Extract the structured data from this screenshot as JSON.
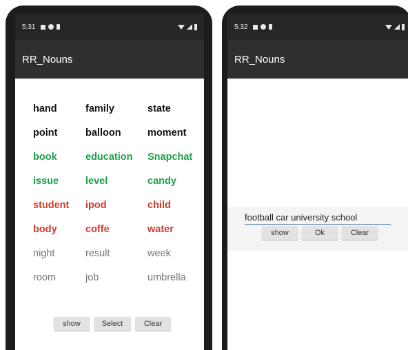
{
  "left_screen": {
    "status": {
      "time": "5:31"
    },
    "app_title": "RR_Nouns",
    "words": [
      {
        "text": "hand",
        "color": "black"
      },
      {
        "text": "family",
        "color": "black"
      },
      {
        "text": "state",
        "color": "black"
      },
      {
        "text": "point",
        "color": "black"
      },
      {
        "text": "balloon",
        "color": "black"
      },
      {
        "text": "moment",
        "color": "black"
      },
      {
        "text": "book",
        "color": "green"
      },
      {
        "text": "education",
        "color": "green"
      },
      {
        "text": "Snapchat",
        "color": "green"
      },
      {
        "text": "issue",
        "color": "green"
      },
      {
        "text": "level",
        "color": "green"
      },
      {
        "text": "candy",
        "color": "green"
      },
      {
        "text": "student",
        "color": "red"
      },
      {
        "text": "ipod",
        "color": "red"
      },
      {
        "text": "child",
        "color": "red"
      },
      {
        "text": "body",
        "color": "red"
      },
      {
        "text": "coffe",
        "color": "red"
      },
      {
        "text": "water",
        "color": "red"
      },
      {
        "text": "night",
        "color": "gray"
      },
      {
        "text": "result",
        "color": "gray"
      },
      {
        "text": "week",
        "color": "gray"
      },
      {
        "text": "room",
        "color": "gray"
      },
      {
        "text": "job",
        "color": "gray"
      },
      {
        "text": "umbrella",
        "color": "gray"
      }
    ],
    "buttons": {
      "show": "show",
      "select": "Select",
      "clear": "Clear"
    }
  },
  "right_screen": {
    "status": {
      "time": "5:32"
    },
    "app_title": "RR_Nouns",
    "input_value": "football car university school",
    "buttons": {
      "show": "show",
      "ok": "Ok",
      "clear": "Clear"
    }
  },
  "colors": {
    "black": "#111111",
    "green": "#1e9e4a",
    "red": "#d23a2c",
    "gray": "#757575",
    "app_bar": "#2f2f2f",
    "status_bar": "#262626"
  }
}
